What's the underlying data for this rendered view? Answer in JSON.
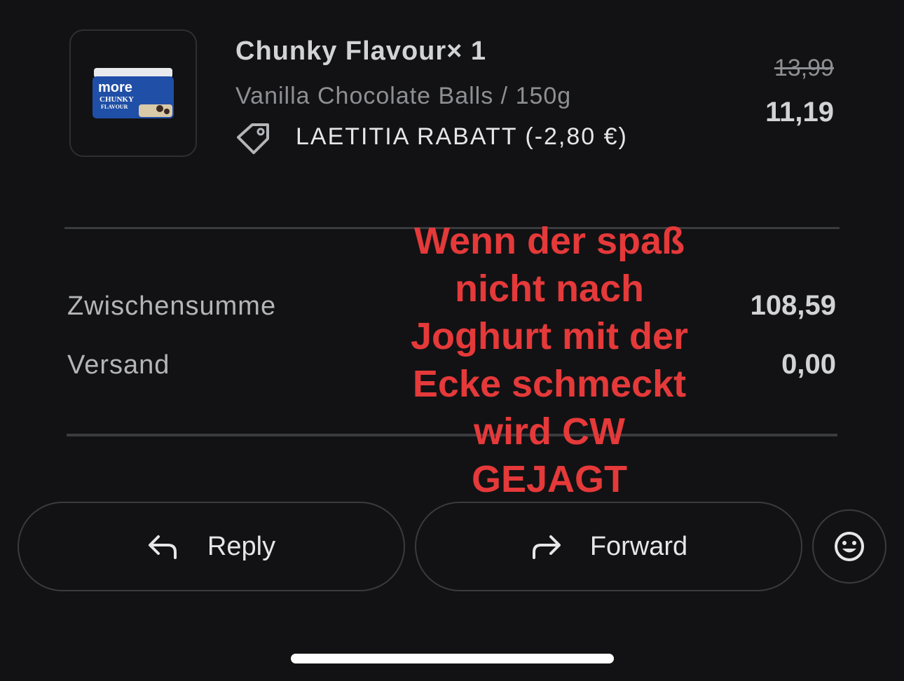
{
  "item": {
    "title": "Chunky Flavour× 1",
    "variant": "Vanilla Chocolate Balls / 150g",
    "discount": "LAETITIA RABATT (-2,80 €)",
    "old_price": "13,99",
    "new_price": "11,19",
    "thumbnail": {
      "brand_text": "more",
      "product_text": "CHUNKY",
      "sub_text": "FLAVOUR"
    },
    "tag_icon": "price-tag-icon"
  },
  "summary": {
    "subtotal_label": "Zwischensumme",
    "subtotal_value": "108,59",
    "shipping_label": "Versand",
    "shipping_value": "0,00"
  },
  "actions": {
    "reply_label": "Reply",
    "reply_icon": "reply-arrow-icon",
    "forward_label": "Forward",
    "forward_icon": "forward-arrow-icon",
    "emoji_icon": "smiley-icon"
  },
  "overlay": {
    "text": "Wenn der spaß nicht nach Joghurt mit der Ecke schmeckt wird CW GEJAGT",
    "color": "#e5393a"
  },
  "colors": {
    "background": "#121214",
    "divider": "#3a3b3f"
  }
}
